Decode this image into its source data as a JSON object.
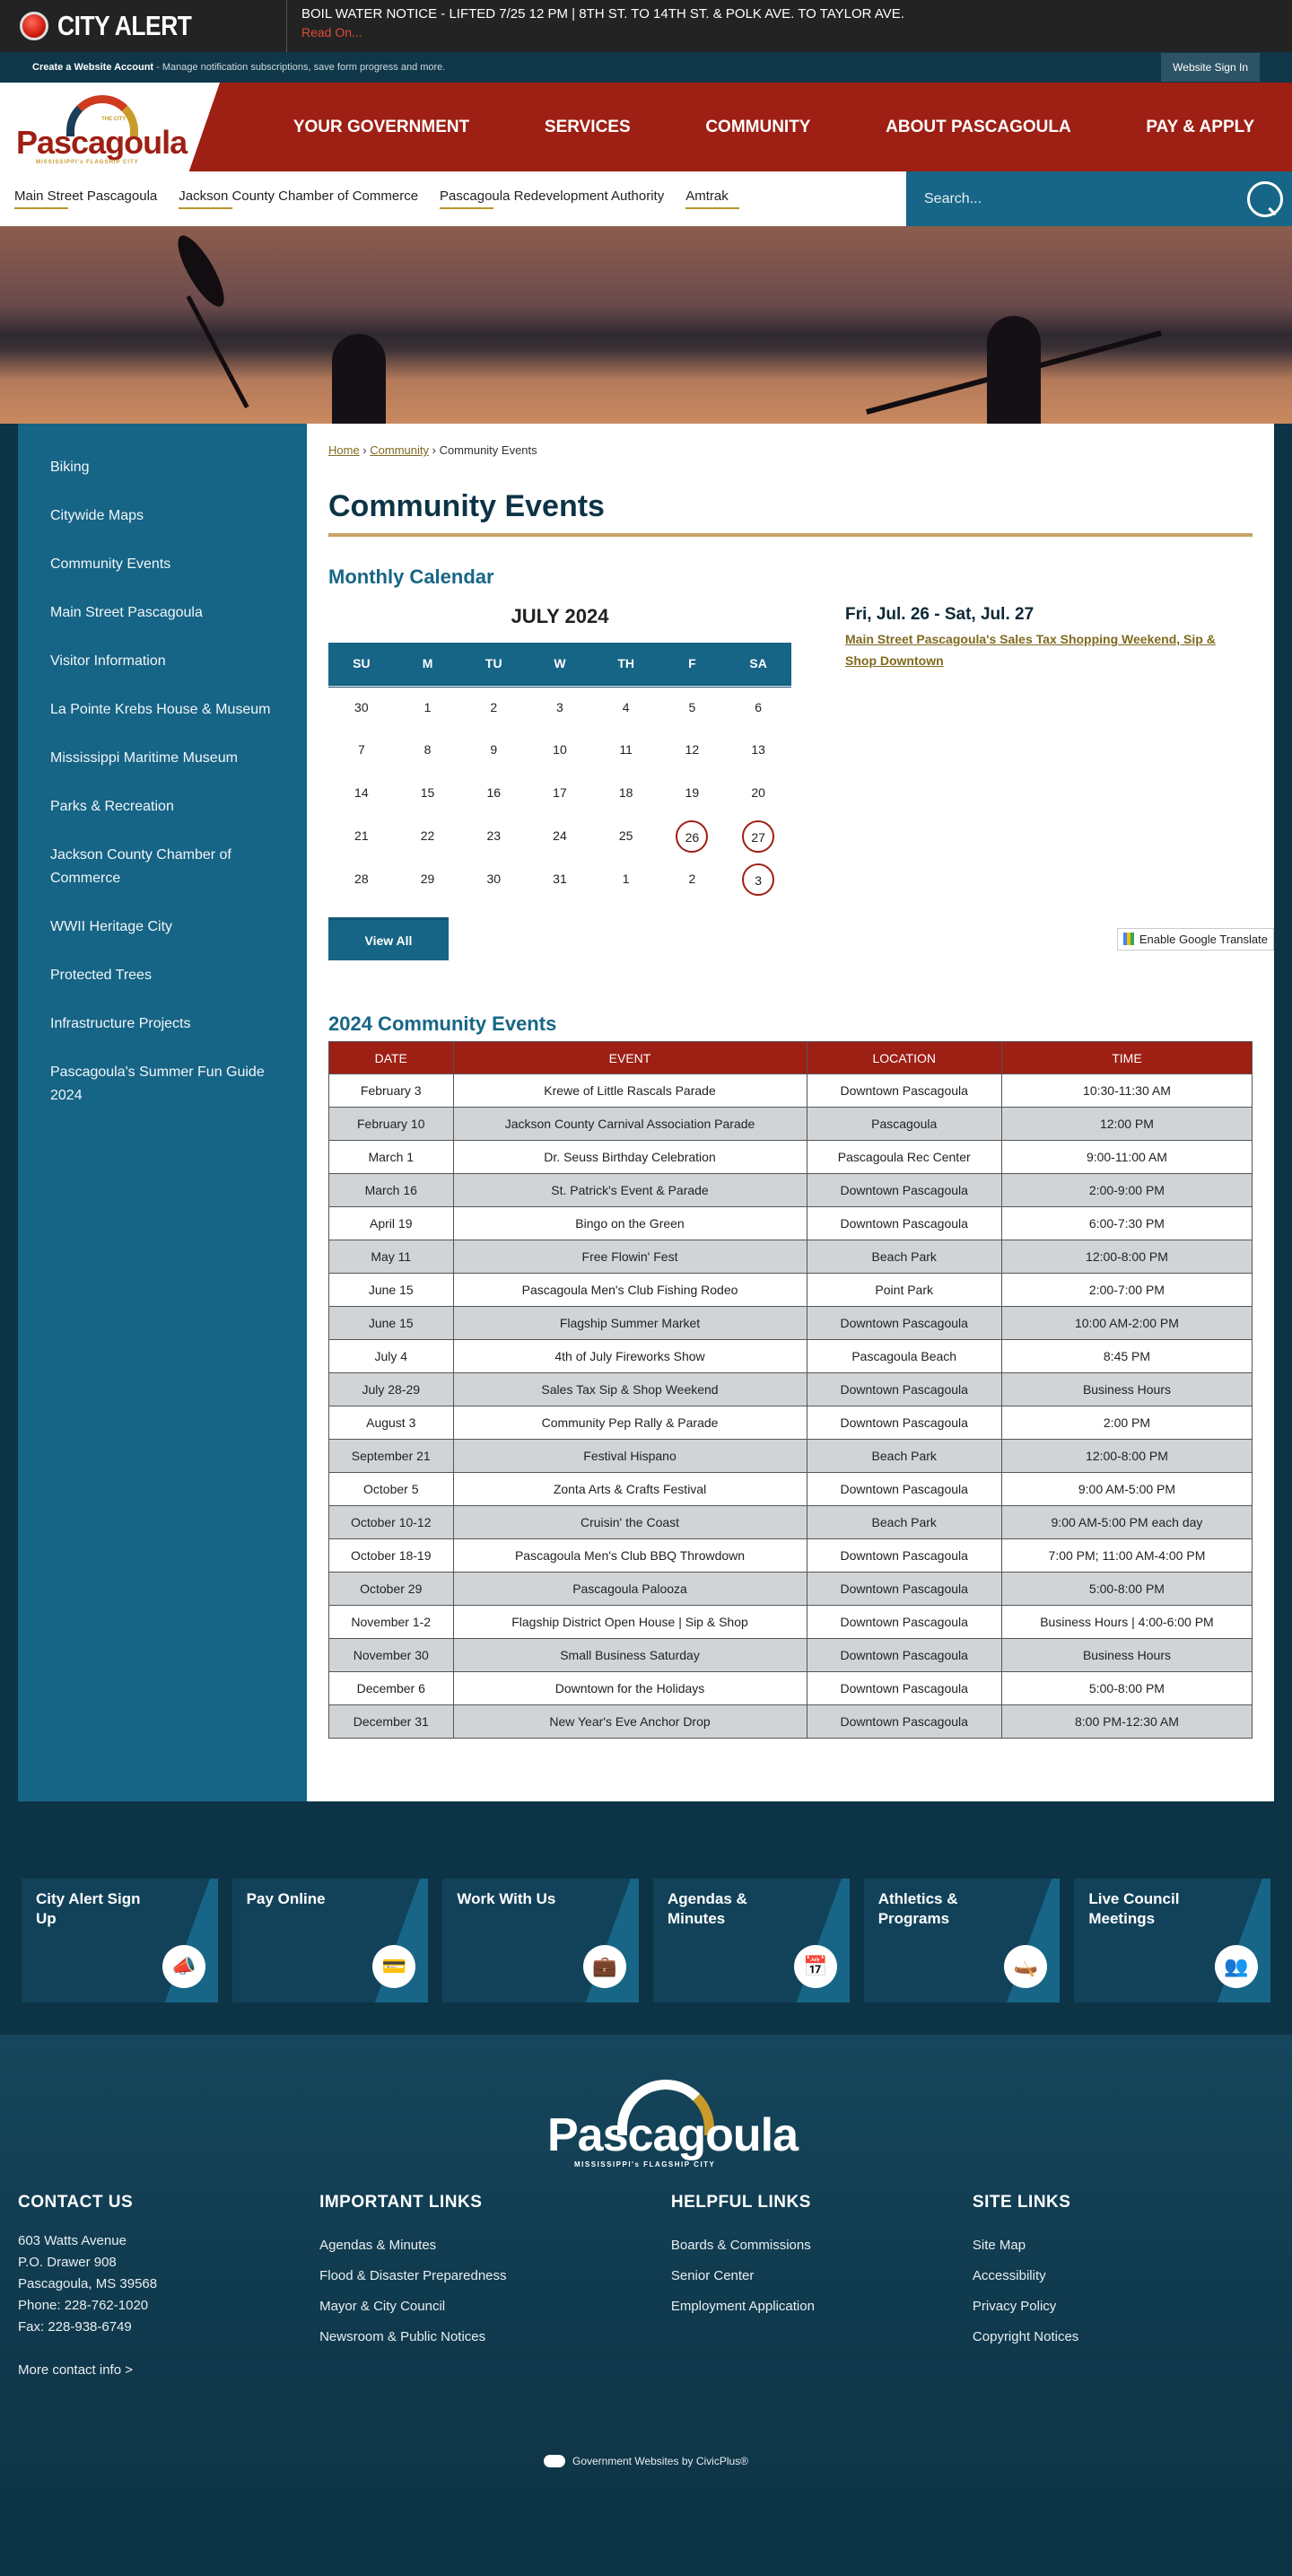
{
  "alert": {
    "title": "CITY ALERT",
    "message": "BOIL WATER NOTICE - LIFTED 7/25 12 PM | 8TH ST. TO 14TH ST. & POLK AVE. TO TAYLOR AVE.",
    "read_on": "Read On..."
  },
  "account_bar": {
    "create_label": "Create a Website Account",
    "create_desc": " - Manage notification subscriptions, save form progress and more.",
    "sign_in": "Website Sign In"
  },
  "logo": {
    "city_of": "THE CITY of",
    "name": "Pascagoula",
    "tagline": "MISSISSIPPI's FLAGSHIP CITY"
  },
  "nav": [
    "YOUR GOVERNMENT",
    "SERVICES",
    "COMMUNITY",
    "ABOUT PASCAGOULA",
    "PAY & APPLY"
  ],
  "quick_links": [
    "Main Street Pascagoula",
    "Jackson County Chamber of Commerce",
    "Pascagoula Redevelopment Authority",
    "Amtrak"
  ],
  "search": {
    "placeholder": "Search..."
  },
  "sidebar": [
    "Biking",
    "Citywide Maps",
    "Community Events",
    "Main Street Pascagoula",
    "Visitor Information",
    "La Pointe Krebs House & Museum",
    "Mississippi Maritime Museum",
    "Parks & Recreation",
    "Jackson County Chamber of Commerce",
    "WWII Heritage City",
    "Protected Trees",
    "Infrastructure Projects",
    "Pascagoula's Summer Fun Guide 2024"
  ],
  "breadcrumb": {
    "home": "Home",
    "community": "Community",
    "current": "Community Events",
    "sep": " › "
  },
  "page_title": "Community Events",
  "calendar": {
    "heading": "Monthly Calendar",
    "month": "JULY 2024",
    "days": [
      "SU",
      "M",
      "TU",
      "W",
      "TH",
      "F",
      "SA"
    ],
    "weeks": [
      [
        "30",
        "1",
        "2",
        "3",
        "4",
        "5",
        "6"
      ],
      [
        "7",
        "8",
        "9",
        "10",
        "11",
        "12",
        "13"
      ],
      [
        "14",
        "15",
        "16",
        "17",
        "18",
        "19",
        "20"
      ],
      [
        "21",
        "22",
        "23",
        "24",
        "25",
        "26",
        "27"
      ],
      [
        "28",
        "29",
        "30",
        "31",
        "1",
        "2",
        "3"
      ]
    ],
    "event_days": [
      "3-5",
      "3-6",
      "4-6"
    ],
    "view_all": "View All"
  },
  "featured_event": {
    "date": "Fri, Jul. 26 - Sat, Jul. 27",
    "title": "Main Street Pascagoula's Sales Tax Shopping Weekend, Sip & Shop Downtown"
  },
  "translate": "Enable Google Translate",
  "events_table": {
    "heading": "2024 Community Events",
    "columns": [
      "DATE",
      "EVENT",
      "LOCATION",
      "TIME"
    ],
    "rows": [
      [
        "February 3",
        "Krewe of Little Rascals Parade",
        "Downtown Pascagoula",
        "10:30-11:30 AM"
      ],
      [
        "February 10",
        "Jackson County Carnival Association Parade",
        "Pascagoula",
        "12:00 PM"
      ],
      [
        "March 1",
        "Dr. Seuss Birthday Celebration",
        "Pascagoula Rec Center",
        "9:00-11:00 AM"
      ],
      [
        "March 16",
        "St. Patrick's Event & Parade",
        "Downtown Pascagoula",
        "2:00-9:00 PM"
      ],
      [
        "April 19",
        "Bingo on the Green",
        "Downtown Pascagoula",
        "6:00-7:30 PM"
      ],
      [
        "May 11",
        "Free Flowin' Fest",
        "Beach Park",
        "12:00-8:00 PM"
      ],
      [
        "June 15",
        "Pascagoula Men's Club Fishing Rodeo",
        "Point Park",
        "2:00-7:00 PM"
      ],
      [
        "June 15",
        "Flagship Summer Market",
        "Downtown Pascagoula",
        "10:00 AM-2:00 PM"
      ],
      [
        "July 4",
        "4th of July Fireworks Show",
        "Pascagoula Beach",
        "8:45 PM"
      ],
      [
        "July 28-29",
        "Sales Tax Sip & Shop Weekend",
        "Downtown Pascagoula",
        "Business Hours"
      ],
      [
        "August 3",
        "Community Pep Rally & Parade",
        "Downtown Pascagoula",
        "2:00 PM"
      ],
      [
        "September 21",
        "Festival Hispano",
        "Beach Park",
        "12:00-8:00 PM"
      ],
      [
        "October 5",
        "Zonta Arts & Crafts Festival",
        "Downtown Pascagoula",
        "9:00 AM-5:00 PM"
      ],
      [
        "October 10-12",
        "Cruisin' the Coast",
        "Beach Park",
        "9:00 AM-5:00 PM each day"
      ],
      [
        "October 18-19",
        "Pascagoula Men's Club BBQ Throwdown",
        "Downtown Pascagoula",
        "7:00 PM; 11:00 AM-4:00 PM"
      ],
      [
        "October 29",
        "Pascagoula Palooza",
        "Downtown Pascagoula",
        "5:00-8:00 PM"
      ],
      [
        "November 1-2",
        "Flagship District Open House | Sip & Shop",
        "Downtown Pascagoula",
        "Business Hours | 4:00-6:00 PM"
      ],
      [
        "November 30",
        "Small Business Saturday",
        "Downtown Pascagoula",
        "Business Hours"
      ],
      [
        "December 6",
        "Downtown for the Holidays",
        "Downtown Pascagoula",
        "5:00-8:00 PM"
      ],
      [
        "December 31",
        "New Year's Eve Anchor Drop",
        "Downtown Pascagoula",
        "8:00 PM-12:30 AM"
      ]
    ]
  },
  "tiles": [
    {
      "label": "City Alert Sign Up",
      "icon": "megaphone-phone-icon",
      "glyph": "📣"
    },
    {
      "label": "Pay Online",
      "icon": "credit-card-icon",
      "glyph": "💳"
    },
    {
      "label": "Work With Us",
      "icon": "briefcase-icon",
      "glyph": "💼"
    },
    {
      "label": "Agendas & Minutes",
      "icon": "calendar-clock-icon",
      "glyph": "📅"
    },
    {
      "label": "Athletics & Programs",
      "icon": "kayak-icon",
      "glyph": "🛶"
    },
    {
      "label": "Live Council Meetings",
      "icon": "meeting-icon",
      "glyph": "👥"
    }
  ],
  "footer": {
    "contact": {
      "heading": "CONTACT US",
      "lines": [
        "603 Watts Avenue",
        "P.O. Drawer 908",
        "Pascagoula, MS 39568",
        "Phone: 228-762-1020",
        "Fax: 228-938-6749"
      ],
      "more": "More contact info >"
    },
    "important": {
      "heading": "IMPORTANT LINKS",
      "links": [
        "Agendas & Minutes",
        "Flood & Disaster Preparedness",
        "Mayor & City Council",
        "Newsroom & Public Notices"
      ]
    },
    "helpful": {
      "heading": "HELPFUL LINKS",
      "links": [
        "Boards & Commissions",
        "Senior Center",
        "Employment Application"
      ]
    },
    "site": {
      "heading": "SITE LINKS",
      "links": [
        "Site Map",
        "Accessibility",
        "Privacy Policy",
        "Copyright Notices"
      ]
    },
    "powered": "Government Websites by CivicPlus®"
  }
}
